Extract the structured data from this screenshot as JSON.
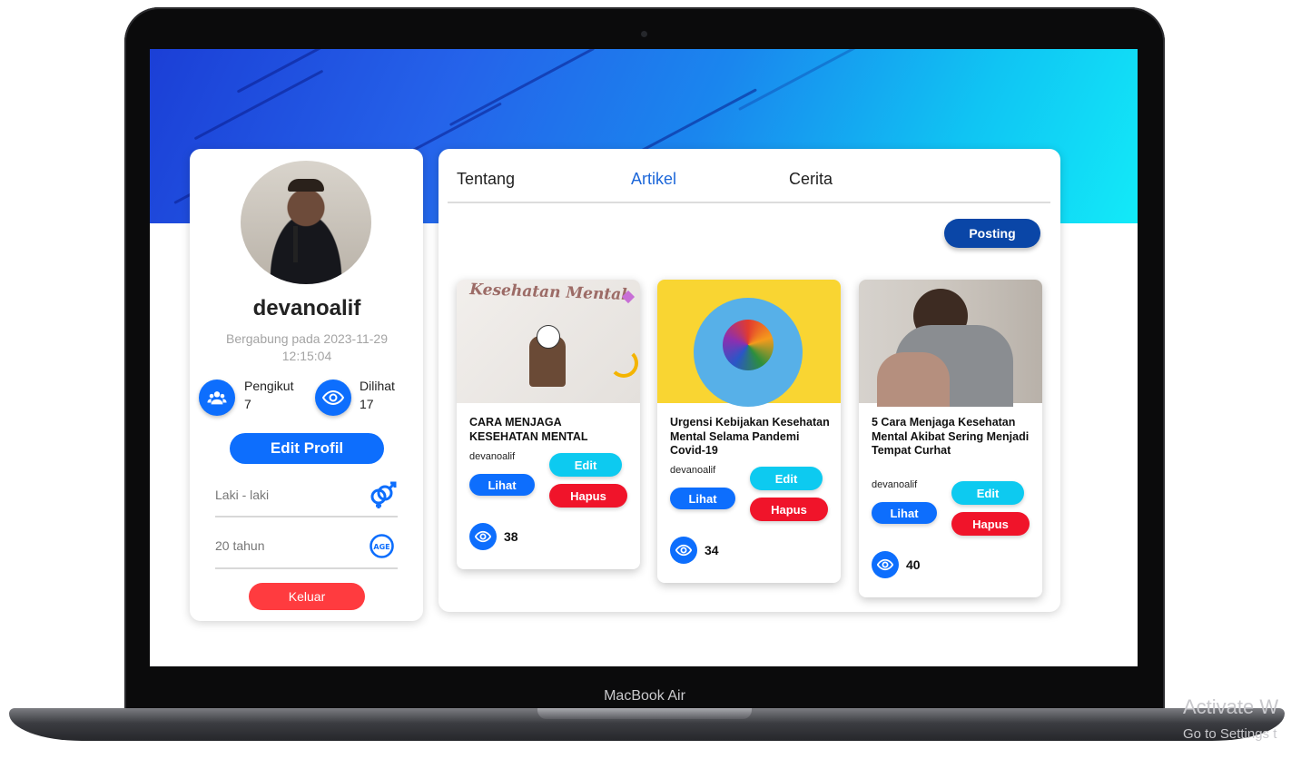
{
  "device": {
    "label": "MacBook Air"
  },
  "watermark": {
    "line1": "Activate W",
    "line2": "Go to Settings t"
  },
  "profile": {
    "username": "devanoalif",
    "joined_line1": "Bergabung pada 2023-11-29",
    "joined_line2": "12:15:04",
    "followers_label": "Pengikut",
    "followers_count": "7",
    "views_label": "Dilihat",
    "views_count": "17",
    "edit_button": "Edit Profil",
    "gender": "Laki - laki",
    "age": "20 tahun",
    "logout_button": "Keluar"
  },
  "tabs": [
    {
      "label": "Tentang",
      "active": false
    },
    {
      "label": "Artikel",
      "active": true
    },
    {
      "label": "Cerita",
      "active": false
    }
  ],
  "posting_button": "Posting",
  "articles": [
    {
      "thumb_title": "Kesehatan Mental",
      "title": "CARA MENJAGA KESEHATAN MENTAL",
      "author": "devanoalif",
      "view_label": "Lihat",
      "edit_label": "Edit",
      "delete_label": "Hapus",
      "views": "38"
    },
    {
      "title": "Urgensi Kebijakan Kesehatan Mental Selama Pandemi Covid-19",
      "author": "devanoalif",
      "view_label": "Lihat",
      "edit_label": "Edit",
      "delete_label": "Hapus",
      "views": "34"
    },
    {
      "title": "5 Cara Menjaga Kesehatan Mental Akibat Sering Menjadi Tempat Curhat",
      "author": "devanoalif",
      "view_label": "Lihat",
      "edit_label": "Edit",
      "delete_label": "Hapus",
      "views": "40"
    }
  ],
  "colors": {
    "primary": "#0d6efd",
    "info": "#0dcaf0",
    "danger": "#f0142a",
    "posting": "#0a46a7",
    "active_tab": "#1d67d9"
  }
}
